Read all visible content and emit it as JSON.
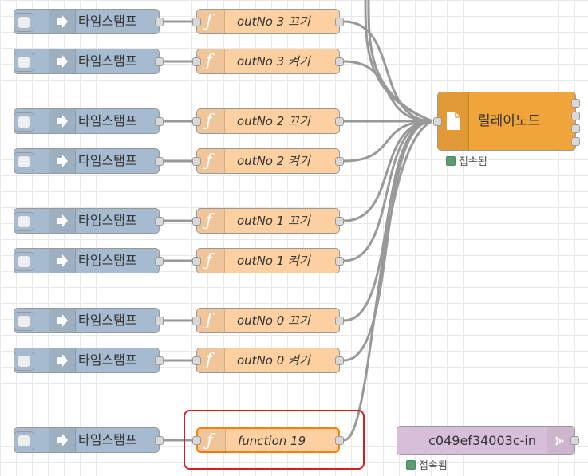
{
  "inject_label": "타임스탬프",
  "functions": [
    {
      "label": "outNo 3 끄기"
    },
    {
      "label": "outNo 3 켜기"
    },
    {
      "label": "outNo 2 끄기"
    },
    {
      "label": "outNo 2 켜기"
    },
    {
      "label": "outNo 1 끄기"
    },
    {
      "label": "outNo 1 켜기"
    },
    {
      "label": "outNo 0 끄기"
    },
    {
      "label": "outNo 0 켜기"
    },
    {
      "label": "function 19"
    }
  ],
  "relay": {
    "label": "릴레이노드",
    "status": "접속됨",
    "icon": "file-icon"
  },
  "websocket_in": {
    "label": "c049ef34003c-in",
    "status": "접속됨",
    "icon": "wifi-icon"
  },
  "colors": {
    "inject": "#a6bbcf",
    "function": "#fdd0a2",
    "relay": "#f0a43a",
    "websocket": "#d7bfd9",
    "status_ok": "#5a9b6f",
    "highlight": "#d21f1f",
    "wire": "#999999"
  }
}
